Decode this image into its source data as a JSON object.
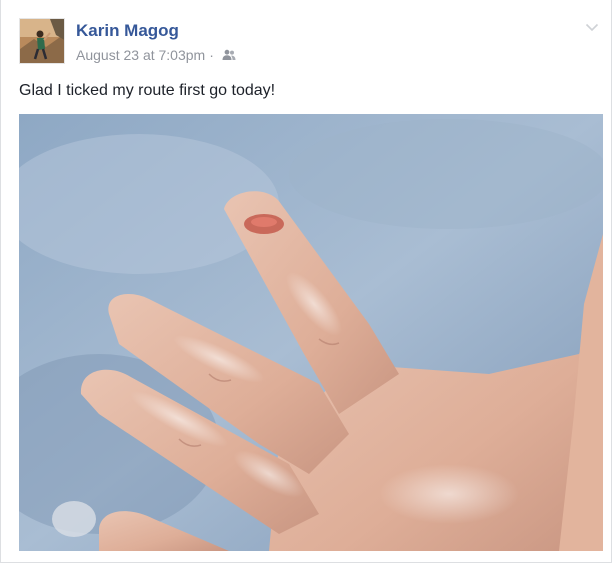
{
  "post": {
    "author": "Karin Magog",
    "timestamp": "August 23 at 7:03pm",
    "separator": "·",
    "audience_icon": "friends-icon",
    "menu_icon": "chevron-down-icon",
    "message": "Glad I ticked my route first go today!"
  },
  "colors": {
    "author_link": "#365899",
    "meta_text": "#90949c",
    "message_text": "#1d2129",
    "card_bg": "#ffffff",
    "page_bg": "#e9ebee"
  }
}
